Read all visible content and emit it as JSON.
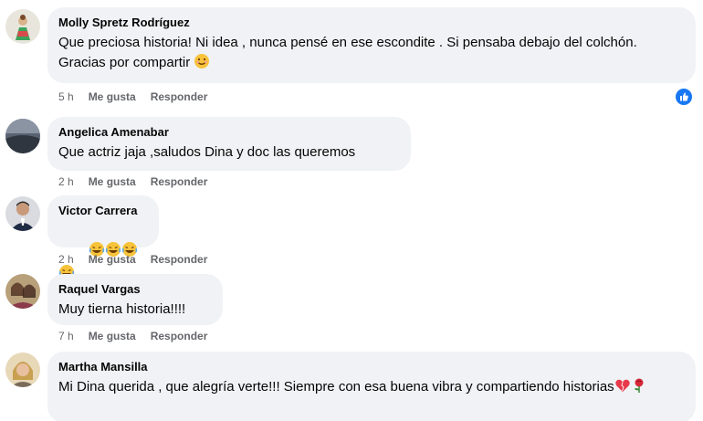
{
  "comments": [
    {
      "author": "Molly Spretz Rodríguez",
      "text": "Que preciosa historia! Ni idea , nunca pensé en ese escondite . Si pensaba debajo del colchón. Gracias por compartir",
      "emoji": "smiling-face",
      "time": "5 h",
      "like_label": "Me gusta",
      "reply_label": "Responder",
      "reaction": "like-icon"
    },
    {
      "author": "Angelica Amenabar",
      "text": "Que actriz jaja ,saludos Dina y doc las queremos",
      "time": "2 h",
      "like_label": "Me gusta",
      "reply_label": "Responder"
    },
    {
      "author": "Victor Carrera",
      "text": "",
      "emoji": "laughing-face x4",
      "time": "2 h",
      "like_label": "Me gusta",
      "reply_label": "Responder"
    },
    {
      "author": "Raquel Vargas",
      "text": "Muy tierna historia!!!!",
      "time": "7 h",
      "like_label": "Me gusta",
      "reply_label": "Responder"
    },
    {
      "author": "Martha Mansilla",
      "text": "Mi Dina querida , que alegría verte!!! Siempre con esa buena vibra y compartiendo historias",
      "emoji": "heart and rose",
      "time": "",
      "like_label": "",
      "reply_label": ""
    }
  ],
  "colors": {
    "bubble": "#f0f2f5",
    "meta": "#65676b",
    "like_blue": "#1877f2"
  }
}
